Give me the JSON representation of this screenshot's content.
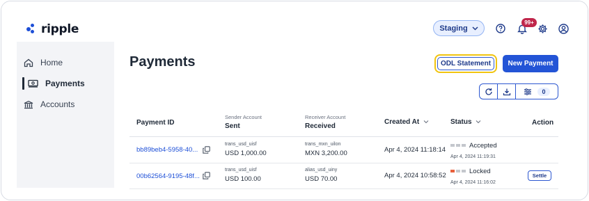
{
  "app": {
    "logo_text": "ripple",
    "brand_color": "#2354d6"
  },
  "header": {
    "environment": "Staging",
    "notification_badge": "99+",
    "icons": [
      "help-circle-icon",
      "bell-icon",
      "settings-gear-icon",
      "user-account-icon"
    ]
  },
  "sidebar": {
    "items": [
      {
        "label": "Home",
        "icon": "home-icon",
        "active": false
      },
      {
        "label": "Payments",
        "icon": "payments-icon",
        "active": true
      },
      {
        "label": "Accounts",
        "icon": "bank-icon",
        "active": false
      }
    ]
  },
  "main": {
    "title": "Payments",
    "odl_button": "ODL Statement",
    "new_button": "New Payment",
    "filter_count": "0"
  },
  "table": {
    "columns": {
      "payment_id": "Payment ID",
      "sender_top": "Sender Account",
      "sender_bottom": "Sent",
      "receiver_top": "Receiver Account",
      "receiver_bottom": "Received",
      "created_at": "Created At",
      "status": "Status",
      "action": "Action"
    },
    "rows": [
      {
        "id": "bb89beb4-5958-40...",
        "sender_account": "trans_usd_uisf",
        "sent": "USD  1,000.00",
        "receiver_account": "trans_mxn_uilon",
        "received": "MXN 3,200.00",
        "created_at": "Apr 4, 2024 11:18:14",
        "status": "Accepted",
        "status_time": "Apr 4, 2024 11:19:31",
        "status_color": "#c4c7cd",
        "action": ""
      },
      {
        "id": "00b62564-9195-48f...",
        "sender_account": "trans_usd_uisf",
        "sent": "USD  100.00",
        "receiver_account": "alias_usd_uiny",
        "received": "USD  70.00",
        "created_at": "Apr 4, 2024 10:58:52",
        "status": "Locked",
        "status_time": "Apr 4, 2024 11:16:02",
        "status_color": "#e8603c",
        "action": "Settle"
      }
    ]
  }
}
